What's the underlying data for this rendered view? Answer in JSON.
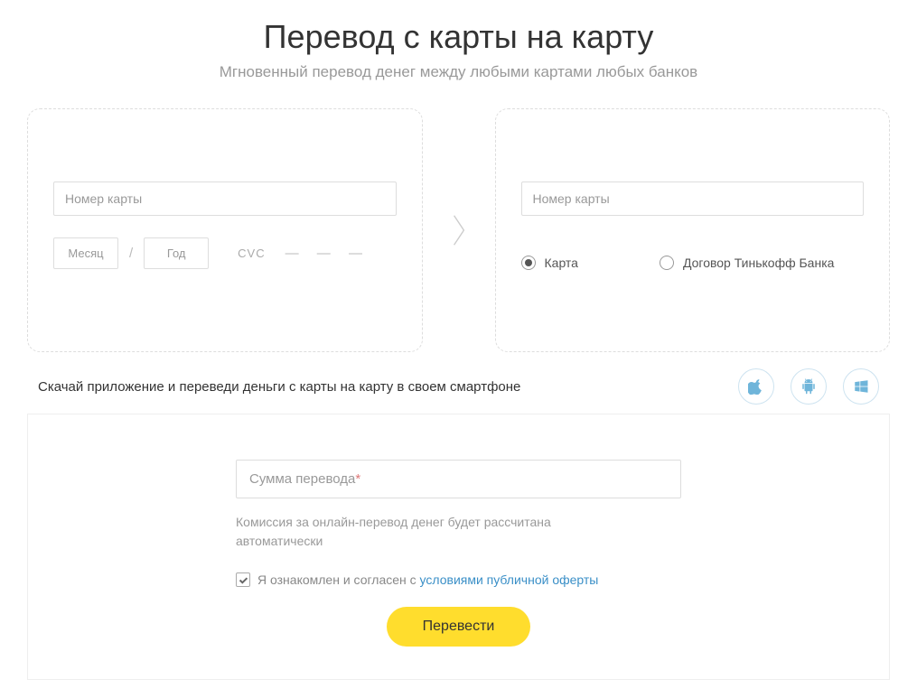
{
  "header": {
    "title": "Перевод с карты на карту",
    "subtitle": "Мгновенный перевод денег между любыми картами любых банков"
  },
  "from_card": {
    "number_placeholder": "Номер карты",
    "month_placeholder": "Месяц",
    "year_placeholder": "Год",
    "cvc_label": "CVC",
    "cvc_dash": "—   —   —"
  },
  "to_card": {
    "number_placeholder": "Номер карты",
    "option_card": "Карта",
    "option_contract": "Договор Тинькофф Банка"
  },
  "promo": {
    "text": "Скачай приложение и переведи деньги с карты на карту в своем смартфоне"
  },
  "amount": {
    "placeholder_main": "Сумма перевода",
    "placeholder_req": "*",
    "fee_note": "Комиссия за онлайн-перевод денег будет рассчитана автоматически"
  },
  "agree": {
    "prefix": "Я ознакомлен и согласен с ",
    "link": "условиями публичной оферты"
  },
  "submit": {
    "label": "Перевести"
  }
}
